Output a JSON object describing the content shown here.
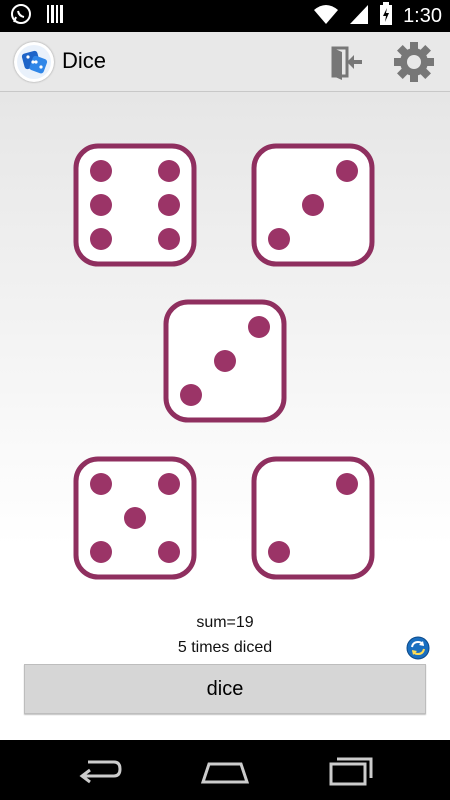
{
  "status_bar": {
    "time": "1:30",
    "icons": [
      "whatsapp-icon",
      "barcode-icon",
      "wifi-icon",
      "signal-icon",
      "battery-charging-icon"
    ]
  },
  "app_bar": {
    "title": "Dice",
    "app_icon": "dice-app-icon",
    "actions": [
      "exit-icon",
      "gear-icon"
    ]
  },
  "dice": [
    {
      "value": 6
    },
    {
      "value": 3
    },
    {
      "value": 3
    },
    {
      "value": 5
    },
    {
      "value": 2
    }
  ],
  "colors": {
    "pip": "#9b3467",
    "die_border": "#8f2f5f",
    "die_face": "#ffffff"
  },
  "results": {
    "sum_text": "sum=19",
    "count_text": "5 times diced"
  },
  "dice_button": {
    "label": "dice"
  },
  "nav_bar": {
    "buttons": [
      "back-icon",
      "home-icon",
      "recent-apps-icon"
    ]
  }
}
